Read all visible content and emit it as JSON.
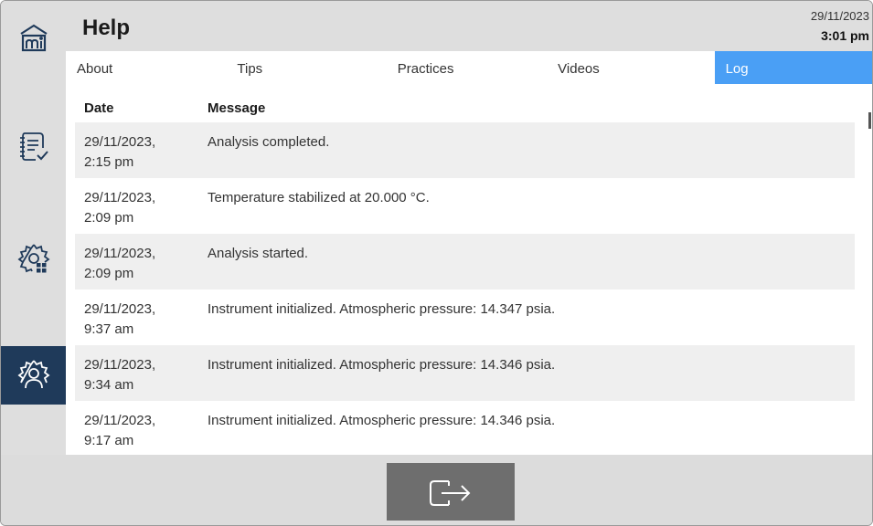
{
  "header": {
    "title": "Help",
    "date": "29/11/2023",
    "time": "3:01 pm"
  },
  "tabs": [
    {
      "label": "About",
      "active": false
    },
    {
      "label": "Tips",
      "active": false
    },
    {
      "label": "Practices",
      "active": false
    },
    {
      "label": "Videos",
      "active": false
    },
    {
      "label": "Log",
      "active": true
    }
  ],
  "table": {
    "columns": [
      "Date",
      "Message"
    ],
    "rows": [
      {
        "date": "29/11/2023,",
        "time": "2:15 pm",
        "message": "Analysis completed."
      },
      {
        "date": "29/11/2023,",
        "time": "2:09 pm",
        "message": "Temperature stabilized at 20.000 °C."
      },
      {
        "date": "29/11/2023,",
        "time": "2:09 pm",
        "message": "Analysis started."
      },
      {
        "date": "29/11/2023,",
        "time": "9:37 am",
        "message": "Instrument initialized. Atmospheric pressure: 14.347 psia."
      },
      {
        "date": "29/11/2023,",
        "time": "9:34 am",
        "message": "Instrument initialized. Atmospheric pressure: 14.346 psia."
      },
      {
        "date": "29/11/2023,",
        "time": "9:17 am",
        "message": "Instrument initialized. Atmospheric pressure: 14.346 psia."
      }
    ]
  },
  "sidebar": {
    "items": [
      {
        "icon": "home-icon"
      },
      {
        "icon": "checklist-icon"
      },
      {
        "icon": "settings-grid-icon"
      },
      {
        "icon": "user-settings-icon",
        "active": true
      }
    ]
  },
  "footer": {
    "exit_icon": "exit-icon"
  },
  "colors": {
    "active_tab": "#4a9ff5",
    "sidebar_active": "#1f3a5a",
    "chrome_gray": "#dedede",
    "row_alt": "#efefef"
  }
}
